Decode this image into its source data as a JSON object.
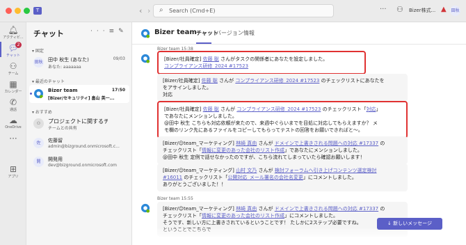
{
  "titlebar": {
    "back_icon": "chevron-left",
    "forward_icon": "chevron-right",
    "search_placeholder": "Search (Cmd+E)",
    "more": "···",
    "org": "Bizer株式...",
    "avatar": "田秋"
  },
  "rail": {
    "items": [
      {
        "label": "アクティビ...",
        "icon": "bell-icon"
      },
      {
        "label": "チャット",
        "icon": "chat-icon",
        "badge": "2"
      },
      {
        "label": "チーム",
        "icon": "teams-icon"
      },
      {
        "label": "カレンダー",
        "icon": "calendar-icon"
      },
      {
        "label": "通話",
        "icon": "phone-icon"
      },
      {
        "label": "OneDrive",
        "icon": "cloud-icon"
      },
      {
        "label": "",
        "icon": "more-icon"
      },
      {
        "label": "アプリ",
        "icon": "apps-icon"
      }
    ]
  },
  "chatlist": {
    "title": "チャット",
    "sections": {
      "pinned": "固定",
      "recent": "最近のチャット",
      "suggested": "おすすめ"
    },
    "pinned_item": {
      "avatar": "田秋",
      "name": "田中 秋生 (あなた)",
      "preview": "あなた: aaaaaaa",
      "time": "09/03"
    },
    "recent_item": {
      "name": "Bizer team",
      "preview": "[Bizer/セキュリティ] 畠山 英一...",
      "time": "17:50"
    },
    "suggested_items": [
      {
        "avatar": "",
        "name": "プロジェクトに関するチャッ...",
        "preview": "チームとの共有"
      },
      {
        "avatar": "佐",
        "name": "佐藤留",
        "preview": "admin@bizground.onmicrosoft.c..."
      },
      {
        "avatar": "開",
        "name": "開発用",
        "preview": "dev@bizground.onmicrosoft.com"
      }
    ]
  },
  "main": {
    "title": "Bizer team",
    "tabs": [
      "チャット",
      "バージョン情報"
    ],
    "stamp1": "Bizer team  15:38",
    "stamp2": "Bizer team  15:55",
    "new_message_button": "↓ 新しいメッセージ",
    "messages": {
      "m1_pre": "[Bizer/社員確定] ",
      "m1_name": "佐藤 聡",
      "m1_mid": " さんがタスクの関係者にあなたを設定しました。",
      "m1_link": "コンプライアンス研修_2024 #17523",
      "m2_pre": "[Bizer/社員確定] ",
      "m2_name": "佐藤 聡",
      "m2_mid": " さんが ",
      "m2_link": "コンプライアンス研修_2024 #17523",
      "m2_post": " のチェックリストにあなたを",
      "m2_line2": "をアサインしました。",
      "m2_line3": "対応",
      "m3_pre": "[Bizer/社員確定] ",
      "m3_name": "佐藤 聡",
      "m3_mid": " さんが ",
      "m3_link": "コンプライアンス研修_2024 #17523",
      "m3_mid2": " のチェックリスト「",
      "m3_check": "対応",
      "m3_post": "」",
      "m3_line2": "であなたにメンションしました。",
      "m3_line3": "@田中 秋生 こちらも対応依頼が来たので、来週中ぐらいまでを目処に対応してもらえますか？ メ",
      "m3_line4": "モ欄のリンク先にあるファイルをコピーしてもらってテストの回答をお願いできればと～。",
      "m4_pre": "[Bizer/☺team_マーケティング] ",
      "m4_name": "林崎 真由",
      "m4_mid": " さんが ",
      "m4_link": "ドメインで上書きされる問題への対応 #17337",
      "m4_post": " の",
      "m4_line2a": "チェックリスト「",
      "m4_line2link": "情報に変更のあった会社のリスト作成",
      "m4_line2b": "」であなたにメンションしました。",
      "m4_line3": "@田中 秋生 定例で話せなかったのですが、こちら流れてしまっていたら確認お願いします！",
      "m5_pre": "[Bizer/☺team_マーケティング] ",
      "m5_name": "山村 文乃",
      "m5_mid": " さんが ",
      "m5_link": "検討フォーラムへ引き上げコンテンツ選定検討",
      "m5_line2link": "#16011",
      "m5_line2a": " のチェックリスト「",
      "m5_line2link2": "公開対応_メール署名の会社名変更",
      "m5_line2b": "」にコメントしました。",
      "m5_line3": "ありがとうございました！！",
      "m6_pre": "[Bizer/☺team_マーケティング] ",
      "m6_name": "林崎 真由",
      "m6_mid": " さんが ",
      "m6_link": "ドメインで上書きされる問題への対応 #17337",
      "m6_post": " の",
      "m6_line2a": "チェックリスト「",
      "m6_line2link": "情報に変更のあった会社のリスト作成",
      "m6_line2b": "」にコメントしました。",
      "m6_line3": "そうです、新しい方に上書きされているということです！ たしかに2ステップ必要ですね。",
      "m6_line4": "ということでこちらで"
    }
  },
  "colors": {
    "accent": "#5b5fc7",
    "highlight_border": "#e03131",
    "link": "#5b5fc7"
  }
}
